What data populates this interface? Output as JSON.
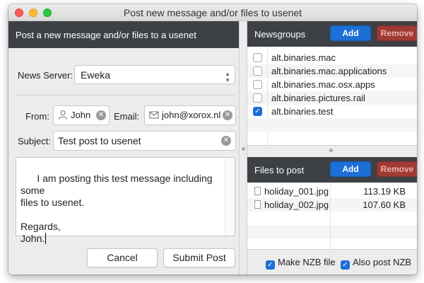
{
  "window": {
    "title": "Post new message and/or files to usenet"
  },
  "left": {
    "header": "Post a new message and/or files to a usenet",
    "news_server_label": "News Server:",
    "news_server_value": "Eweka",
    "from_label": "From:",
    "from_value": "John",
    "email_label": "Email:",
    "email_value": "john@xorox.nl",
    "subject_label": "Subject:",
    "subject_value": "Test post to usenet",
    "message_body": "I am posting this test message including some\nfiles to usenet.\n\nRegards,\nJohn.",
    "cancel_label": "Cancel",
    "submit_label": "Submit Post"
  },
  "newsgroups": {
    "header": "Newsgroups",
    "add_label": "Add",
    "remove_label": "Remove",
    "items": [
      {
        "name": "alt.binaries.mac",
        "checked": false
      },
      {
        "name": "alt.binaries.mac.applications",
        "checked": false
      },
      {
        "name": "alt.binaries.mac.osx.apps",
        "checked": false
      },
      {
        "name": "alt.binaries.pictures.rail",
        "checked": false
      },
      {
        "name": "alt.binaries.test",
        "checked": true
      }
    ]
  },
  "files": {
    "header": "Files to post",
    "add_label": "Add",
    "remove_label": "Remove",
    "items": [
      {
        "name": "holiday_001.jpg",
        "size": "113.19 KB"
      },
      {
        "name": "holiday_002.jpg",
        "size": "107.60 KB"
      }
    ]
  },
  "options": {
    "make_nzb_label": "Make NZB file",
    "make_nzb_checked": true,
    "also_post_nzb_label": "Also post NZB",
    "also_post_nzb_checked": true
  },
  "colors": {
    "header_bg": "#3d4145",
    "accent_blue": "#1c6fd6",
    "remove_red": "#a03a32"
  }
}
